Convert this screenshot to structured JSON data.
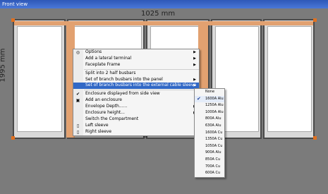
{
  "window": {
    "title": "Front view"
  },
  "dimensions": {
    "width_label": "1025 mm",
    "height_label": "1995 mm"
  },
  "menu": {
    "items": [
      {
        "label": "Options",
        "arrow": true,
        "icon": "options-icon",
        "glyph": "◎"
      },
      {
        "label": "Add a lateral terminal",
        "arrow": true
      },
      {
        "label": "Faceplate Frame",
        "arrow": true
      },
      {
        "sep": true
      },
      {
        "label": "Split into 2 half busbars"
      },
      {
        "label": "Set of branch busbars into the panel",
        "arrow": true
      },
      {
        "label": "Set of branch busbars into the external cable sleeve",
        "arrow": true,
        "selected": true
      },
      {
        "sep": true
      },
      {
        "label": "Enclosure displayed from side view",
        "icon": "check-icon",
        "glyph": "✔"
      },
      {
        "label": "Add an enclosure",
        "icon": "enclosure-icon",
        "glyph": "▣"
      },
      {
        "label": "Envelope Depth......",
        "arrow": true
      },
      {
        "label": "Enclosure height...",
        "arrow": true
      },
      {
        "label": "Switch the Compartment"
      },
      {
        "label": "Left sleeve",
        "icon": "left-sleeve-icon",
        "glyph": "▯"
      },
      {
        "label": "Right sleeve",
        "icon": "right-sleeve-icon",
        "glyph": "▯"
      }
    ]
  },
  "submenu": {
    "items": [
      {
        "label": "None"
      },
      {
        "label": "1600A Alu",
        "checked": true
      },
      {
        "label": "1250A Alu"
      },
      {
        "label": "1000A Alu"
      },
      {
        "label": "800A Alu"
      },
      {
        "label": "630A Alu"
      },
      {
        "label": "1600A Cu"
      },
      {
        "label": "1350A Cu"
      },
      {
        "label": "1050A Cu"
      },
      {
        "label": "900A Alu"
      },
      {
        "label": "850A Cu"
      },
      {
        "label": "700A Cu"
      },
      {
        "label": "600A Cu"
      }
    ]
  },
  "colors": {
    "selection": "#3168c6",
    "busbar": "#e2a170",
    "handle": "#e07020"
  }
}
